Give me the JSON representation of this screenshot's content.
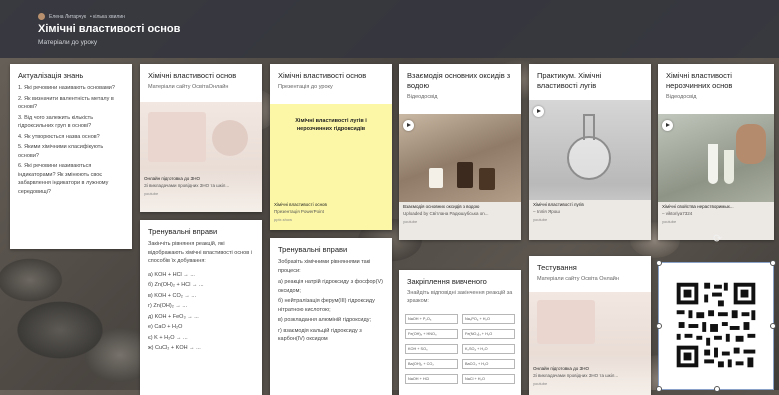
{
  "header": {
    "author": "Елена Литарчук",
    "time": "• кілька хвилин",
    "title": "Хімічні властивості основ",
    "subtitle": "Матеріали до уроку"
  },
  "col1": {
    "card1": {
      "title": "Актуалізація знань",
      "items": [
        "1. Які речовини називають основами?",
        "2. Як визначити валентність металу в основі?",
        "3. Від чого залежить кількість гідроксильних груп в основі?",
        "4. Як утворюється назва основ?",
        "5. Якими хімічними класифікують основи?",
        "6. Які речовини називаються індикаторами? Як змінюють своє забарвлення індикатори в лужному середовищі?"
      ]
    }
  },
  "col2": {
    "card1": {
      "title": "Хімічні властивості основ",
      "sub": "Матеріали сайту ОсвітаОнлайн",
      "link_caption1": "Онлайн підготовка до ЗНО",
      "link_caption2": "Зі викладачами провідних ЗНО та шкіл...",
      "link_src": "youtube"
    },
    "card2": {
      "title": "Тренувальні вправи",
      "body": "Закінчіть рівняння реакцій, які відображають хімічні властивості основ і способів їх добування:",
      "eqs": [
        "а) KOH + HCl → ...",
        "б) Zn(OH)₂ + HCl → ...",
        "в) KOH + CO₂ → ...",
        "г) Zn(OH)₂ → ...",
        "д) KOH + FeO₃ → ...",
        "е) CaO + H₂O",
        "є) K + H₂O → ...",
        "ж) CuCl₂ + KOH → ..."
      ]
    }
  },
  "col3": {
    "card1": {
      "title": "Хімічні властивості основ",
      "sub": "Презентація до уроку",
      "slide_title": "Хімічні властивості лугів і нерозчинних гідроксидів",
      "caption1": "Хімічні властивості основ",
      "caption2": "Презентація PowerPoint",
      "src": "pptx.show"
    },
    "card2": {
      "title": "Тренувальні вправи",
      "body": "Зобразіть хімічними рівняннями такі процеси:",
      "items": [
        "а) реакція натрій гідроксиду з фосфор(V) оксидом;",
        "б) нейтралізація ферум(III) гідроксиду нітратною кислотою;",
        "в) розкладання алюміній гідроксиду;",
        "г) взаємодія кальцій гідроксиду з карбон(IV) оксидом"
      ]
    }
  },
  "col4": {
    "card1": {
      "title": "Взаємодія основних оксидів з водою",
      "sub": "Відеодосвід",
      "caption1": "Взаємодія основних оксидів з водою",
      "caption2": "Uploaded by Світлана Радюшубська on...",
      "src": "youtube"
    },
    "card2": {
      "title": "Закріплення вивченого",
      "sub": "Знайдіть відповідні закінчення реакцій за зразком:",
      "cells": [
        [
          "NaOH + P₂O₅",
          "Na₃PO₄ + H₂O"
        ],
        [
          "Fe(OH)₃ + HNO₃",
          "Fe(NO₃)₃ + H₂O"
        ],
        [
          "KOH + SO₃",
          "K₂SO₄ + H₂O"
        ],
        [
          "Ba(OH)₂ + CO₂",
          "BaCO₃ + H₂O"
        ],
        [
          "NaOH + HCl",
          "NaCl + H₂O"
        ]
      ]
    }
  },
  "col5": {
    "card1": {
      "title": "Практикум. Хімічні властивості лугів",
      "caption1": "Хімічні властивості лугів",
      "caption2": "– Іллія Ярош",
      "src": "youtube"
    },
    "card2": {
      "title": "Тестування",
      "sub": "Матеріали сайту Освіта Онлайн",
      "caption1": "Онлайн підготовка до ЗНО",
      "caption2": "Зі викладачами провідних ЗНО та шкіл...",
      "src": "youtube"
    }
  },
  "col6": {
    "card1": {
      "title": "Хімічні властивості нерозчинних основ",
      "sub": "Відеодосвід",
      "caption1": "Хімічні свойства нерастворимых...",
      "caption2": "– viktoriya7324",
      "src": "youtube"
    }
  }
}
